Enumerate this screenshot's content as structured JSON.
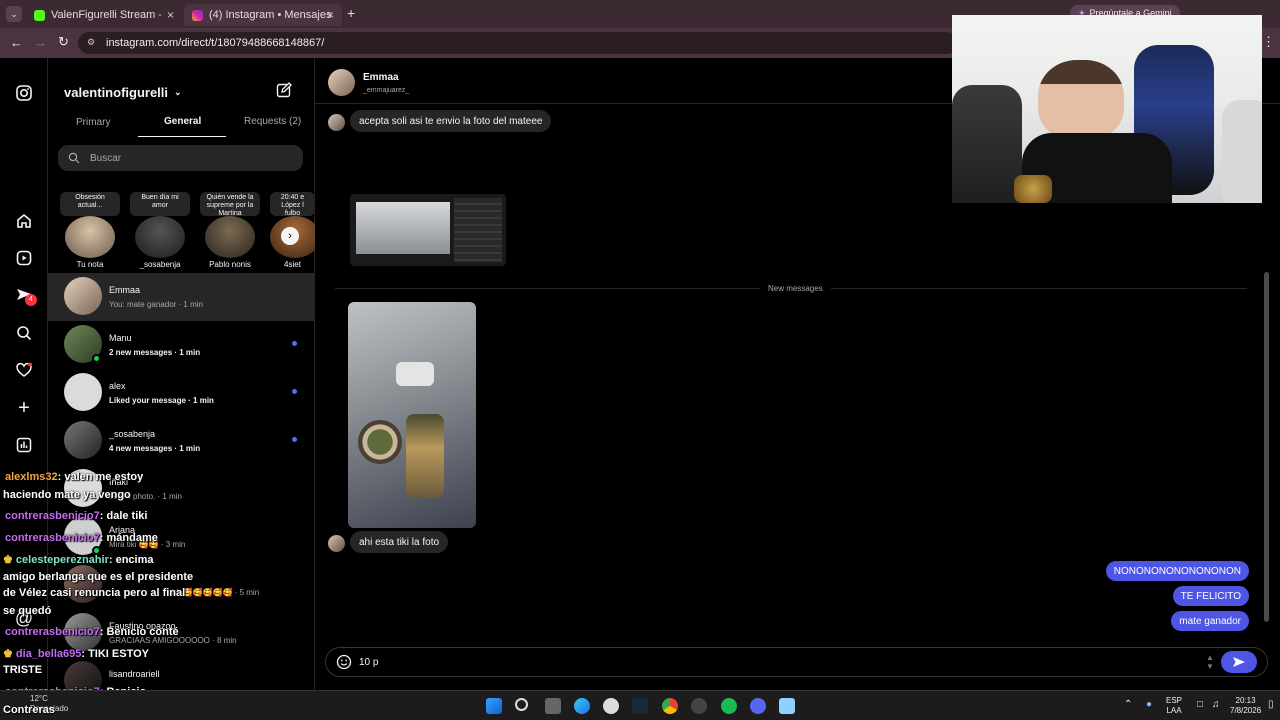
{
  "browser": {
    "tabs": [
      {
        "label": "ValenFigurelli Stream - Watch l",
        "active": false
      },
      {
        "label": "(4) Instagram • Mensajes",
        "active": true
      }
    ],
    "url": "instagram.com/direct/t/18079488668148867/",
    "gemini_label": "Pregúntale a Gemini"
  },
  "sidebar": {
    "username": "valentinofigurelli",
    "tabs": [
      "Primary",
      "General",
      "Requests (2)"
    ],
    "active_tab": "General",
    "search_placeholder": "Buscar",
    "notes": [
      {
        "bubble": "Obsesión actual...",
        "name": "Tu nota"
      },
      {
        "bubble": "Buen día mi amor",
        "name": "_sosabenja"
      },
      {
        "bubble": "Quién vende la supreme por la Martina",
        "name": "Pablo nonis"
      },
      {
        "bubble": "20:40 e López l fulbo",
        "name": "4siet"
      }
    ],
    "conversations": [
      {
        "name": "Emmaa",
        "sub": "You: mate ganador · 1 min",
        "unread": false,
        "active": true
      },
      {
        "name": "Manu",
        "sub": "2 new messages · 1 min",
        "unread": true
      },
      {
        "name": "alex",
        "sub": "Liked your message · 1 min",
        "unread": true
      },
      {
        "name": "_sosabenja",
        "sub": "4 new messages · 1 min",
        "unread": true
      },
      {
        "name": "Iñaki",
        "sub": "sent a photo. · 1 min",
        "unread": false
      },
      {
        "name": "Ariana",
        "sub": "Mira tiki 🥰🥰 · 3 min",
        "unread": false
      },
      {
        "name": "",
        "sub": "vida🥰🥰🥰🥰🥰 · 5 min",
        "unread": false
      },
      {
        "name": "Faustino opazoo",
        "sub": "GRACIAAS AMIGOOOOOO · 8 min",
        "unread": false
      },
      {
        "name": "lisandroariell",
        "sub": "",
        "unread": false
      }
    ],
    "badge_count": "4"
  },
  "chat": {
    "contact_name": "Emmaa",
    "contact_handle": "_emmajuarez_",
    "messages_in": [
      "acepta soli asi te envio la foto del mateee",
      "ahi esta tiki la foto"
    ],
    "new_messages_label": "New messages",
    "messages_out": [
      "NONONONONONONONON",
      "TE FELICITO",
      "mate ganador"
    ],
    "composer_text": "10 p"
  },
  "stream_chat": [
    {
      "user": "alexlms32",
      "text": ": valen me estoy",
      "color": "orange"
    },
    {
      "user": "",
      "text": "haciendo mate ya vengo",
      "color": ""
    },
    {
      "user": "contrerasbenicio7",
      "text": ": dale tiki",
      "color": "purple"
    },
    {
      "user": "contrerasbenicio7",
      "text": ": mándame",
      "color": "purple"
    },
    {
      "user": "celestepereznahir",
      "text": ": encima",
      "color": "green"
    },
    {
      "user": "",
      "text": "amigo berlanga que es el presidente",
      "color": ""
    },
    {
      "user": "",
      "text": "de Vélez casi renuncia pero al final",
      "color": ""
    },
    {
      "user": "",
      "text": "se quedó",
      "color": ""
    },
    {
      "user": "contrerasbenicio7",
      "text": ": Benicio conté",
      "color": "purple"
    },
    {
      "user": "dia_bella695",
      "text": ": TIKI ESTOY",
      "color": "purple"
    },
    {
      "user": "",
      "text": "TRISTE",
      "color": ""
    },
    {
      "user": "contrerasbenicio7",
      "text": ": Benicio",
      "color": "purple"
    },
    {
      "user": "",
      "text": "Contreras",
      "color": ""
    }
  ],
  "taskbar": {
    "weather_temp": "12°C",
    "weather_desc": "Despejado",
    "lang_top": "ESP",
    "lang_bottom": "LAA",
    "time": "20:13",
    "date": "7/8/2026"
  },
  "colors": {
    "accent": "#4f56e6",
    "tabbar": "#3c2a33",
    "bubble_in": "#262626"
  }
}
